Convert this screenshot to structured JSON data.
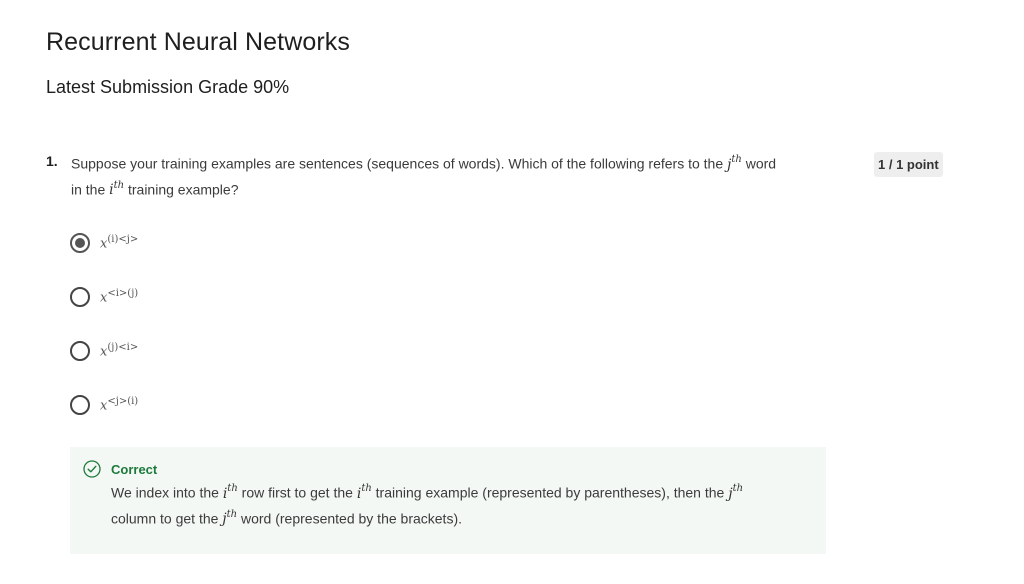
{
  "page": {
    "title": "Recurrent Neural Networks",
    "grade_line": "Latest Submission Grade 90%"
  },
  "question": {
    "number": "1.",
    "text_part1": "Suppose your training examples are sentences (sequences of words). Which of the following refers to the ",
    "math_j": "j",
    "math_th": "th",
    "text_part2": " word",
    "text_part3": "in the ",
    "math_i": "i",
    "text_part4": " training example?",
    "points": "1 / 1 point",
    "options": [
      {
        "base": "x",
        "sup": "(i)<j>",
        "selected": true
      },
      {
        "base": "x",
        "sup": "<i>(j)",
        "selected": false
      },
      {
        "base": "x",
        "sup": "(j)<i>",
        "selected": false
      },
      {
        "base": "x",
        "sup": "<j>(i)",
        "selected": false
      }
    ]
  },
  "feedback": {
    "status": "Correct",
    "status_color": "#1e7a3c",
    "icon": "check-circle-icon",
    "line1_a": "We index into the ",
    "line1_b": " row first to get the ",
    "line1_c": " training example (represented by parentheses), then the ",
    "line2_a": "column to get the ",
    "line2_b": " word (represented by the brackets)."
  }
}
